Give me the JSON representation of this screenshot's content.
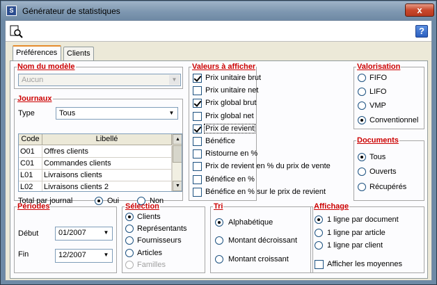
{
  "window": {
    "title": "Générateur de statistiques",
    "close": "x"
  },
  "toolbar": {
    "help": "?"
  },
  "tabs": [
    {
      "label": "Préférences"
    },
    {
      "label": "Clients"
    }
  ],
  "modele": {
    "legend": "Nom du modèle",
    "value": "Aucun"
  },
  "journaux": {
    "legend": "Journaux",
    "type_label": "Type",
    "type_value": "Tous",
    "columns": [
      "Code",
      "Libellé"
    ],
    "rows": [
      [
        "O01",
        "Offres clients"
      ],
      [
        "C01",
        "Commandes clients"
      ],
      [
        "L01",
        "Livraisons clients"
      ],
      [
        "L02",
        "Livraisons clients 2"
      ]
    ],
    "total_label": "Total par journal",
    "oui": "Oui",
    "non": "Non"
  },
  "valeurs": {
    "legend": "Valeurs à afficher",
    "items": [
      {
        "label": "Prix unitaire brut",
        "checked": true
      },
      {
        "label": "Prix unitaire net",
        "checked": false
      },
      {
        "label": "Prix global brut",
        "checked": true
      },
      {
        "label": "Prix global net",
        "checked": false
      },
      {
        "label": "Prix de revient",
        "checked": true
      },
      {
        "label": "Bénéfice",
        "checked": false
      },
      {
        "label": "Ristourne en %",
        "checked": false
      },
      {
        "label": "Prix de revient en % du prix de vente",
        "checked": false
      },
      {
        "label": "Bénéfice en %",
        "checked": false
      },
      {
        "label": "Bénéfice en % sur le prix de revient",
        "checked": false
      }
    ]
  },
  "valorisation": {
    "legend": "Valorisation",
    "options": [
      "FIFO",
      "LIFO",
      "VMP",
      "Conventionnel"
    ],
    "selected": 3
  },
  "documents": {
    "legend": "Documents",
    "options": [
      "Tous",
      "Ouverts",
      "Récupérés"
    ],
    "selected": 0
  },
  "periodes": {
    "legend": "Périodes",
    "debut_label": "Début",
    "debut_value": "01/2007",
    "fin_label": "Fin",
    "fin_value": "12/2007"
  },
  "selection": {
    "legend": "Sélection",
    "options": [
      "Clients",
      "Représentants",
      "Fournisseurs",
      "Articles",
      "Familles"
    ],
    "selected": 0,
    "disabled": [
      4
    ]
  },
  "tri": {
    "legend": "Tri",
    "options": [
      "Alphabétique",
      "Montant décroissant",
      "Montant croissant"
    ],
    "selected": 0
  },
  "affichage": {
    "legend": "Affichage",
    "options": [
      "1 ligne par document",
      "1 ligne par article",
      "1 ligne par client"
    ],
    "selected": 0,
    "moyennes_label": "Afficher les moyennes",
    "moyennes_checked": false
  }
}
